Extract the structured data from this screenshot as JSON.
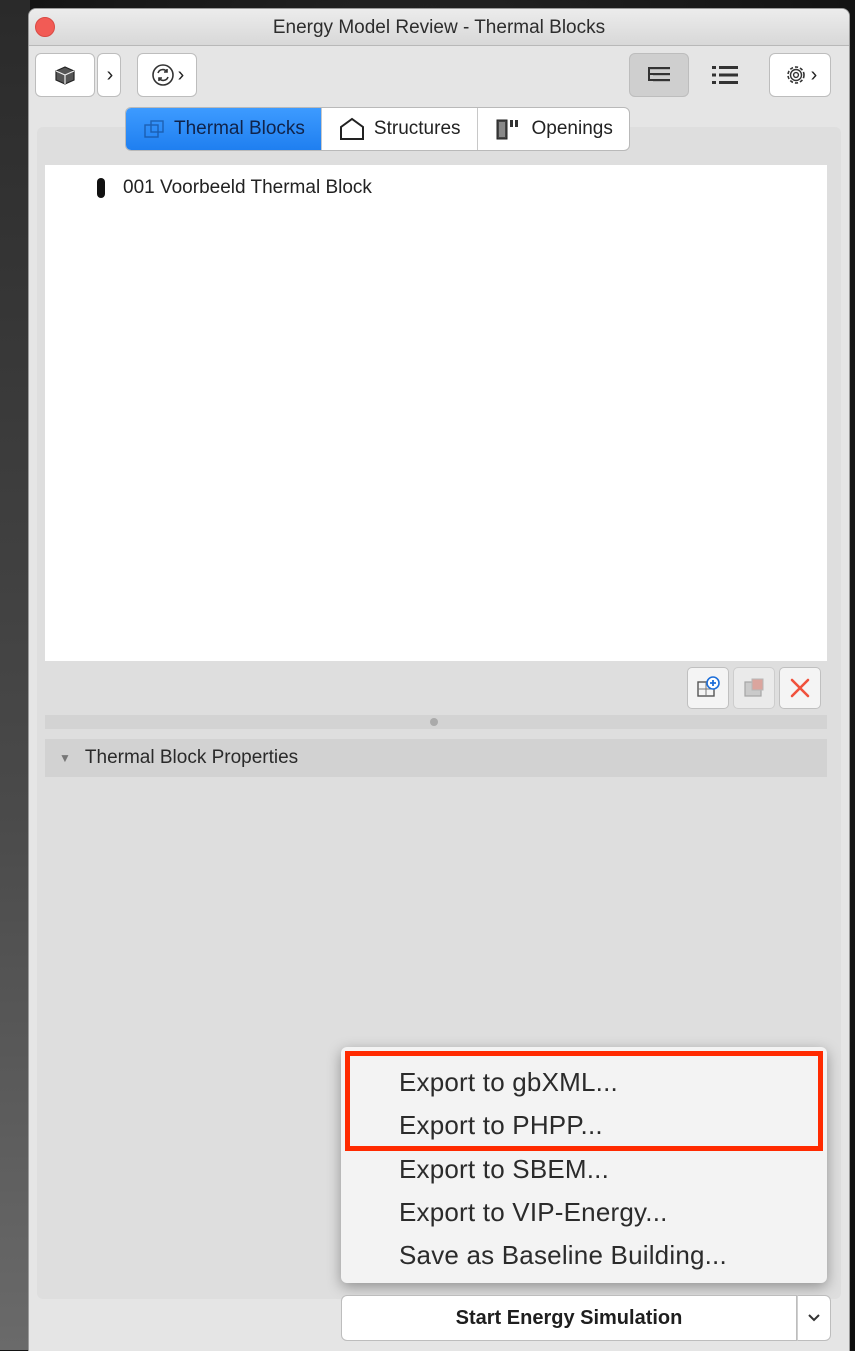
{
  "window": {
    "title": "Energy Model Review - Thermal Blocks"
  },
  "tabs": [
    {
      "label": "Thermal Blocks",
      "icon": "thermal-block-icon",
      "selected": true
    },
    {
      "label": "Structures",
      "icon": "house-icon",
      "selected": false
    },
    {
      "label": "Openings",
      "icon": "door-icon",
      "selected": false
    }
  ],
  "thermal_blocks": {
    "items": [
      {
        "label": "001 Voorbeeld Thermal Block"
      }
    ]
  },
  "properties": {
    "header": "Thermal Block Properties",
    "expanded": true
  },
  "export_menu": {
    "items": [
      "Export to gbXML...",
      "Export to PHPP...",
      "Export to SBEM...",
      "Export to VIP-Energy...",
      "Save as Baseline Building..."
    ],
    "highlight_color": "#ff2a00"
  },
  "start_button": {
    "label": "Start Energy Simulation"
  },
  "colors": {
    "accent": "#1f7ff0",
    "close_button": "#f25b55"
  }
}
